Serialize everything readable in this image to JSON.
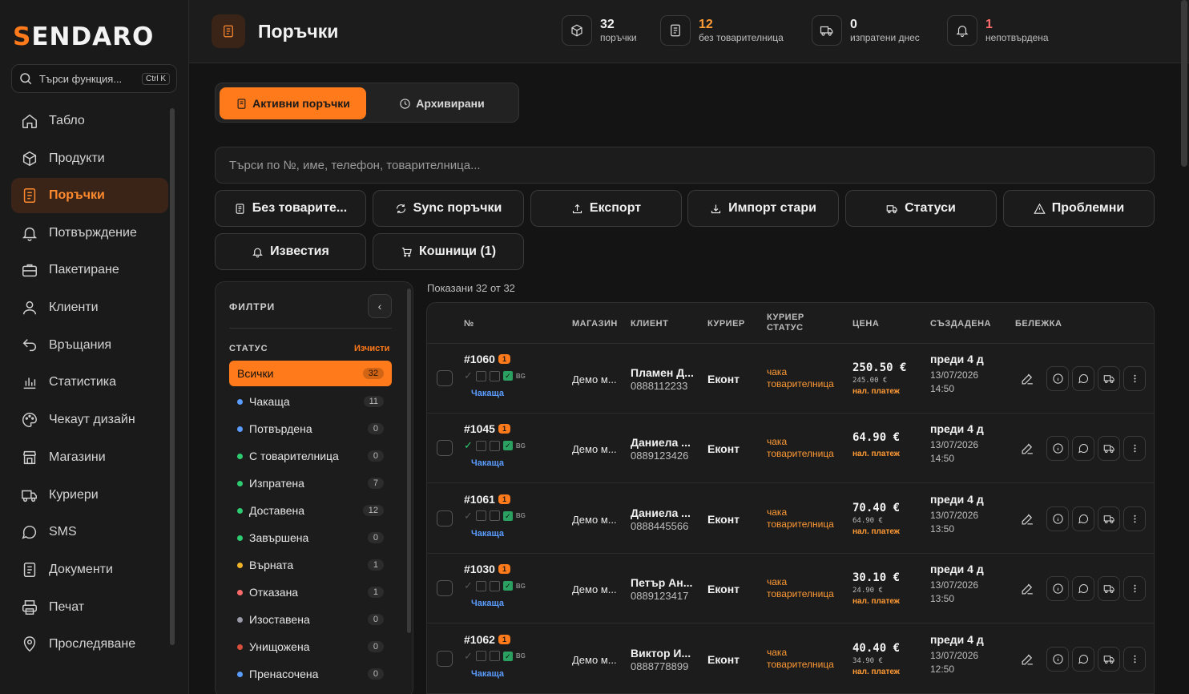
{
  "app": {
    "logo_first": "S",
    "logo_rest": "ENDARO"
  },
  "search": {
    "placeholder": "Търси функция...",
    "shortcut": "Ctrl K"
  },
  "sidebar": {
    "items": [
      {
        "label": "Табло",
        "icon": "home-icon"
      },
      {
        "label": "Продукти",
        "icon": "box-icon"
      },
      {
        "label": "Поръчки",
        "icon": "orders-icon",
        "active": true
      },
      {
        "label": "Потвърждение",
        "icon": "bell-icon"
      },
      {
        "label": "Пакетиране",
        "icon": "briefcase-icon"
      },
      {
        "label": "Клиенти",
        "icon": "user-icon"
      },
      {
        "label": "Връщания",
        "icon": "return-icon"
      },
      {
        "label": "Статистика",
        "icon": "chart-icon"
      },
      {
        "label": "Чекаут дизайн",
        "icon": "palette-icon"
      },
      {
        "label": "Магазини",
        "icon": "store-icon"
      },
      {
        "label": "Куриери",
        "icon": "truck-icon"
      },
      {
        "label": "SMS",
        "icon": "chat-icon"
      },
      {
        "label": "Документи",
        "icon": "document-icon"
      },
      {
        "label": "Печат",
        "icon": "printer-icon"
      },
      {
        "label": "Проследяване",
        "icon": "pin-icon"
      }
    ]
  },
  "header": {
    "title": "Поръчки",
    "stats": [
      {
        "num": "32",
        "label": "поръчки",
        "icon": "box-icon",
        "color": "#f0f0f0"
      },
      {
        "num": "12",
        "label": "без товарителница",
        "icon": "document-icon",
        "color": "#ff9a35"
      },
      {
        "num": "0",
        "label": "изпратени днес",
        "icon": "truck-icon",
        "color": "#f0f0f0"
      },
      {
        "num": "1",
        "label": "непотвърдена",
        "icon": "bell-icon",
        "color": "#ff6b6b"
      }
    ]
  },
  "tabs": {
    "active": "Активни поръчки",
    "archived": "Архивирани"
  },
  "main_search": {
    "placeholder": "Търси по №, име, телефон, товарителница..."
  },
  "actions": [
    "Без товарите...",
    "Sync поръчки",
    "Експорт",
    "Импорт стари",
    "Статуси",
    "Проблемни",
    "Известия",
    "Кошници  (1)"
  ],
  "filters": {
    "title": "ФИЛТРИ",
    "status_title": "СТАТУС",
    "clear": "Изчисти",
    "items": [
      {
        "label": "Всички",
        "count": "32",
        "color": "",
        "active": true
      },
      {
        "label": "Чакаща",
        "count": "11",
        "color": "#5b9cff"
      },
      {
        "label": "Потвърдена",
        "count": "0",
        "color": "#5b9cff"
      },
      {
        "label": "С товарителница",
        "count": "0",
        "color": "#2ecc71"
      },
      {
        "label": "Изпратена",
        "count": "7",
        "color": "#2ecc71"
      },
      {
        "label": "Доставена",
        "count": "12",
        "color": "#2ecc71"
      },
      {
        "label": "Завършена",
        "count": "0",
        "color": "#2ecc71"
      },
      {
        "label": "Върната",
        "count": "1",
        "color": "#f0b429"
      },
      {
        "label": "Отказана",
        "count": "1",
        "color": "#ff6b6b"
      },
      {
        "label": "Изоставена",
        "count": "0",
        "color": "#9a9aa8"
      },
      {
        "label": "Унищожена",
        "count": "0",
        "color": "#d64f3a"
      },
      {
        "label": "Пренасочена",
        "count": "0",
        "color": "#5b9cff"
      }
    ]
  },
  "shown_text": "Показани 32 от 32",
  "table": {
    "headers": {
      "no": "№",
      "shop": "МАГАЗИН",
      "client": "КЛИЕНТ",
      "courier": "КУРИЕР",
      "courier_status_1": "КУРИЕР",
      "courier_status_2": "СТАТУС",
      "price": "ЦЕНА",
      "created": "СЪЗДАДЕНА",
      "note": "БЕЛЕЖКА"
    },
    "rows": [
      {
        "id": "#1060",
        "badge": "1",
        "checked": false,
        "country": "BG",
        "status": "Чакаща",
        "shop": "Демо м...",
        "client": "Пламен Д...",
        "phone": "0888112233",
        "courier": "Еконт",
        "cstat1": "чака",
        "cstat2": "товарителница",
        "price": "250.50 €",
        "old": "245.00 €",
        "cod": "нал. платеж",
        "ago": "преди 4 д",
        "date": "13/07/2026",
        "time": "14:50"
      },
      {
        "id": "#1045",
        "badge": "1",
        "checked": true,
        "country": "BG",
        "status": "Чакаща",
        "shop": "Демо м...",
        "client": "Даниела ...",
        "phone": "0889123426",
        "courier": "Еконт",
        "cstat1": "чака",
        "cstat2": "товарителница",
        "price": "64.90 €",
        "old": "",
        "cod": "нал. платеж",
        "ago": "преди 4 д",
        "date": "13/07/2026",
        "time": "14:50"
      },
      {
        "id": "#1061",
        "badge": "1",
        "checked": false,
        "country": "BG",
        "status": "Чакаща",
        "shop": "Демо м...",
        "client": "Даниела ...",
        "phone": "0888445566",
        "courier": "Еконт",
        "cstat1": "чака",
        "cstat2": "товарителница",
        "price": "70.40 €",
        "old": "64.90 €",
        "cod": "нал. платеж",
        "ago": "преди 4 д",
        "date": "13/07/2026",
        "time": "13:50"
      },
      {
        "id": "#1030",
        "badge": "1",
        "checked": false,
        "country": "BG",
        "status": "Чакаща",
        "shop": "Демо м...",
        "client": "Петър Ан...",
        "phone": "0889123417",
        "courier": "Еконт",
        "cstat1": "чака",
        "cstat2": "товарителница",
        "price": "30.10 €",
        "old": "24.90 €",
        "cod": "нал. платеж",
        "ago": "преди 4 д",
        "date": "13/07/2026",
        "time": "13:50"
      },
      {
        "id": "#1062",
        "badge": "1",
        "checked": false,
        "country": "BG",
        "status": "Чакаща",
        "shop": "Демо м...",
        "client": "Виктор И...",
        "phone": "0888778899",
        "courier": "Еконт",
        "cstat1": "чака",
        "cstat2": "товарителница",
        "price": "40.40 €",
        "old": "34.90 €",
        "cod": "нал. платеж",
        "ago": "преди 4 д",
        "date": "13/07/2026",
        "time": "12:50"
      }
    ]
  }
}
